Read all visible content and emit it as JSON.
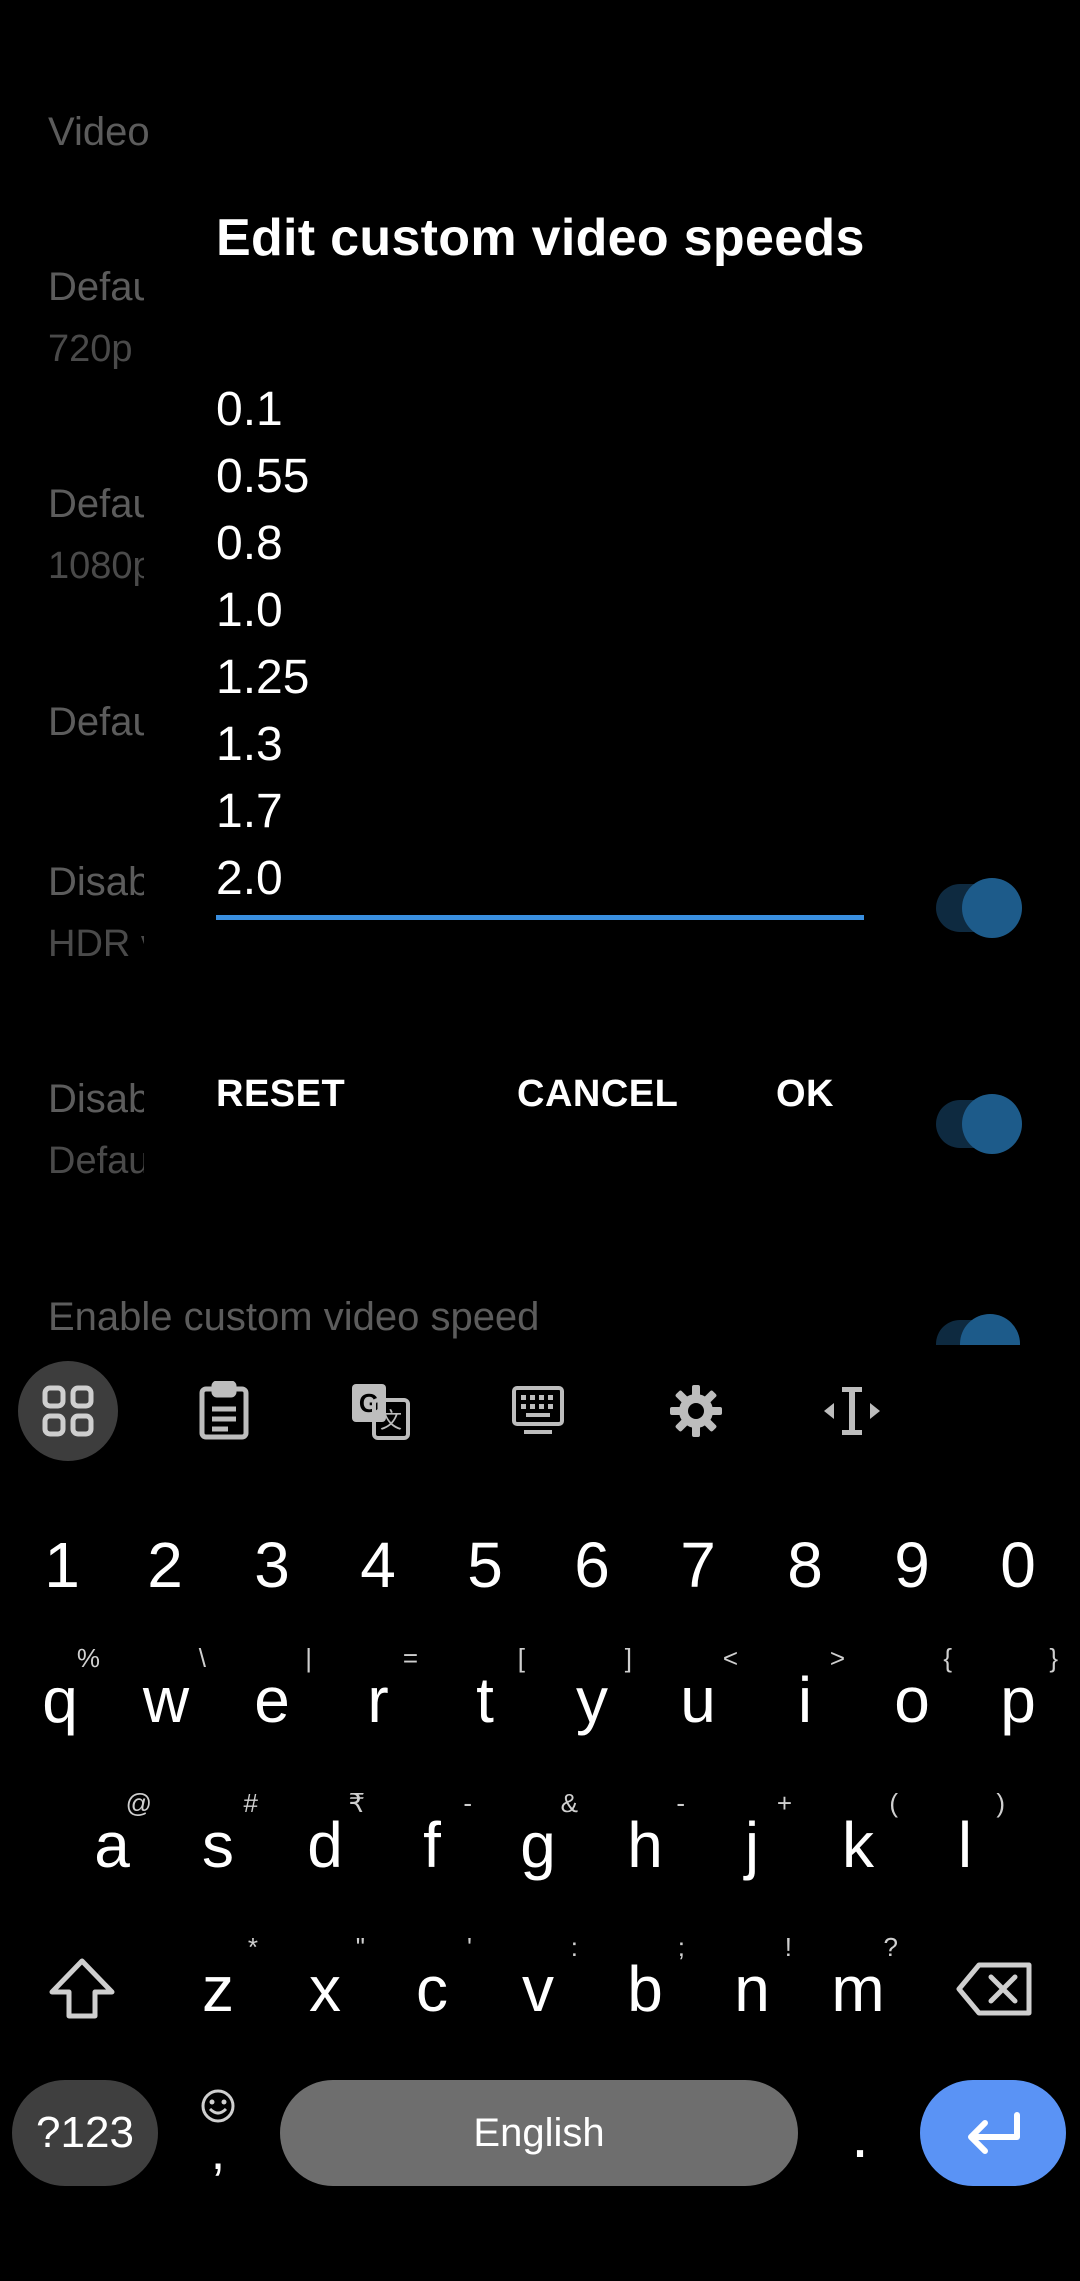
{
  "background": {
    "section_header": "Video",
    "rows": [
      {
        "title": "Defau",
        "summary": "720p"
      },
      {
        "title": "Defau",
        "summary": "1080p"
      },
      {
        "title": "Defau",
        "summary": ""
      },
      {
        "title": "Disab",
        "summary": "HDR v"
      },
      {
        "title": "Disab",
        "summary": "Defau"
      }
    ],
    "enable_custom_label": "Enable custom video speed"
  },
  "dialog": {
    "title": "Edit custom video speeds",
    "speeds": [
      "0.1",
      "0.55",
      "0.8",
      "1.0",
      "1.25",
      "1.3",
      "1.7",
      "2.0"
    ],
    "reset_label": "RESET",
    "cancel_label": "CANCEL",
    "ok_label": "OK"
  },
  "keyboard": {
    "toolbar": [
      "apps-grid-icon",
      "clipboard-icon",
      "translate-icon",
      "keyboard-icon",
      "settings-gear-icon",
      "cursor-text-icon"
    ],
    "number_row": [
      "1",
      "2",
      "3",
      "4",
      "5",
      "6",
      "7",
      "8",
      "9",
      "0"
    ],
    "row1": [
      {
        "key": "q",
        "hint": "%"
      },
      {
        "key": "w",
        "hint": "\\"
      },
      {
        "key": "e",
        "hint": "|"
      },
      {
        "key": "r",
        "hint": "="
      },
      {
        "key": "t",
        "hint": "["
      },
      {
        "key": "y",
        "hint": "]"
      },
      {
        "key": "u",
        "hint": "<"
      },
      {
        "key": "i",
        "hint": ">"
      },
      {
        "key": "o",
        "hint": "{"
      },
      {
        "key": "p",
        "hint": "}"
      }
    ],
    "row2": [
      {
        "key": "a",
        "hint": "@"
      },
      {
        "key": "s",
        "hint": "#"
      },
      {
        "key": "d",
        "hint": "₹"
      },
      {
        "key": "f",
        "hint": "-"
      },
      {
        "key": "g",
        "hint": "&"
      },
      {
        "key": "h",
        "hint": "-"
      },
      {
        "key": "j",
        "hint": "+"
      },
      {
        "key": "k",
        "hint": "("
      },
      {
        "key": "l",
        "hint": ")"
      }
    ],
    "row3": [
      {
        "key": "z",
        "hint": "*"
      },
      {
        "key": "x",
        "hint": "\""
      },
      {
        "key": "c",
        "hint": "'"
      },
      {
        "key": "v",
        "hint": ":"
      },
      {
        "key": "b",
        "hint": ";"
      },
      {
        "key": "n",
        "hint": "!"
      },
      {
        "key": "m",
        "hint": "?"
      }
    ],
    "symbols_label": "?123",
    "comma_label": ",",
    "space_label": "English",
    "period_label": ".",
    "accent_color": "#5a93f5"
  }
}
